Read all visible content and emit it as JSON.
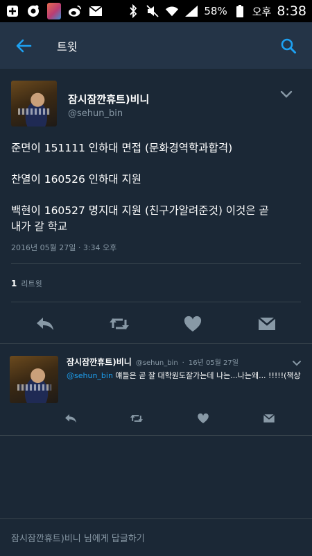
{
  "status_bar": {
    "battery": "58%",
    "ampm": "오후",
    "time": "8:38",
    "icons": [
      "plus-box-icon",
      "cookie-icon",
      "app-thumbnail-icon",
      "weibo-icon",
      "mail-icon",
      "bluetooth-icon",
      "mute-icon",
      "wifi-icon",
      "signal-icon",
      "battery-icon"
    ]
  },
  "toolbar": {
    "title": "트윗",
    "back_icon": "back-arrow-icon",
    "search_icon": "search-icon"
  },
  "main_tweet": {
    "display_name": "잠시잠깐휴트)비니",
    "handle": "@sehun_bin",
    "lines": [
      "준면이 151111 인하대 면접 (문화경역학과합격)",
      "찬열이 160526 인하대 지원",
      "백현이 160527 명지대 지원 (친구가알려준것) 이것은 곧",
      "내가 갈 학교"
    ],
    "timestamp": "2016년 05월 27일 · 3:34 오후",
    "retweet_count": "1",
    "retweet_label": "리트윗"
  },
  "reply_tweet": {
    "display_name": "잠시잠깐휴트)비니",
    "handle": "@sehun_bin",
    "separator": "·",
    "date": "16년 05월 27일",
    "mention": "@sehun_bin",
    "text": " 얘들은 곧 잘 대학원도잘가는데 나는...나는왜... !!!!!(책상 쾅"
  },
  "reply_bar": {
    "placeholder": "잠시잠깐휴트)비니 님에게 답글하기"
  },
  "colors": {
    "background": "#1b2836",
    "toolbar": "#243447",
    "accent": "#1da1f2",
    "secondary_text": "#8899a6",
    "icon": "#8899a6"
  }
}
